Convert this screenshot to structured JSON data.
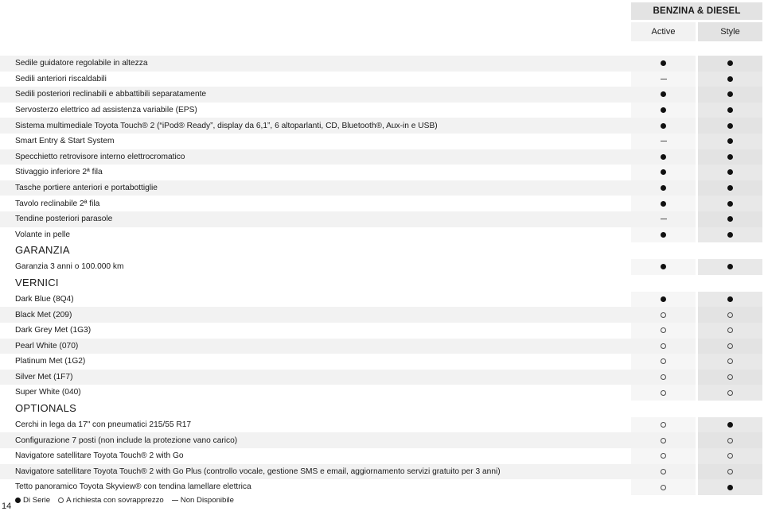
{
  "header": {
    "fuel_band_label": "BENZINA & DIESEL",
    "grades": [
      {
        "label": "Active"
      },
      {
        "label": "Style"
      }
    ]
  },
  "colors": {
    "stripe_feature": "#f2f2f2",
    "active_col": "#f2f2f2",
    "style_col": "#e3e3e3",
    "band": "#e3e3e3",
    "text": "#1a1a1a",
    "marker_filled": "#111111",
    "marker_open_border": "#4a4a4a"
  },
  "rows": [
    {
      "type": "item",
      "label": "Sedile guidatore regolabile in altezza",
      "active": "filled",
      "style": "filled"
    },
    {
      "type": "item",
      "label": "Sedili anteriori riscaldabili",
      "active": "dash",
      "style": "filled"
    },
    {
      "type": "item",
      "label": "Sedili posteriori reclinabili e abbattibili separatamente",
      "active": "filled",
      "style": "filled"
    },
    {
      "type": "item",
      "label": "Servosterzo elettrico ad assistenza variabile (EPS)",
      "active": "filled",
      "style": "filled"
    },
    {
      "type": "item",
      "label": "Sistema multimediale Toyota Touch® 2 (“iPod® Ready”, display da 6,1”, 6 altoparlanti, CD, Bluetooth®, Aux-in e USB)",
      "active": "filled",
      "style": "filled"
    },
    {
      "type": "item",
      "label": "Smart Entry & Start System",
      "active": "dash",
      "style": "filled"
    },
    {
      "type": "item",
      "label": "Specchietto retrovisore interno elettrocromatico",
      "active": "filled",
      "style": "filled"
    },
    {
      "type": "item",
      "label": "Stivaggio inferiore 2ª fila",
      "active": "filled",
      "style": "filled"
    },
    {
      "type": "item",
      "label": "Tasche portiere anteriori e portabottiglie",
      "active": "filled",
      "style": "filled"
    },
    {
      "type": "item",
      "label": "Tavolo reclinabile 2ª fila",
      "active": "filled",
      "style": "filled"
    },
    {
      "type": "item",
      "label": "Tendine posteriori parasole",
      "active": "dash",
      "style": "filled"
    },
    {
      "type": "item",
      "label": "Volante in pelle",
      "active": "filled",
      "style": "filled"
    },
    {
      "type": "section",
      "label": "GARANZIA",
      "active": "none",
      "style": "none"
    },
    {
      "type": "item",
      "label": "Garanzia 3 anni o 100.000 km",
      "active": "filled",
      "style": "filled"
    },
    {
      "type": "section",
      "label": "VERNICI",
      "active": "none",
      "style": "none"
    },
    {
      "type": "item",
      "label": "Dark Blue (8Q4)",
      "active": "filled",
      "style": "filled"
    },
    {
      "type": "item",
      "label": "Black Met (209)",
      "active": "open",
      "style": "open"
    },
    {
      "type": "item",
      "label": "Dark Grey Met (1G3)",
      "active": "open",
      "style": "open"
    },
    {
      "type": "item",
      "label": "Pearl White (070)",
      "active": "open",
      "style": "open"
    },
    {
      "type": "item",
      "label": "Platinum Met (1G2)",
      "active": "open",
      "style": "open"
    },
    {
      "type": "item",
      "label": "Silver Met (1F7)",
      "active": "open",
      "style": "open"
    },
    {
      "type": "item",
      "label": "Super White (040)",
      "active": "open",
      "style": "open"
    },
    {
      "type": "section",
      "label": "OPTIONALS",
      "active": "none",
      "style": "none"
    },
    {
      "type": "item",
      "label": "Cerchi in lega da 17\" con pneumatici 215/55 R17",
      "active": "open",
      "style": "filled"
    },
    {
      "type": "item",
      "label": "Configurazione 7 posti (non include la protezione vano carico)",
      "active": "open",
      "style": "open"
    },
    {
      "type": "item",
      "label": "Navigatore satellitare Toyota Touch® 2 with Go",
      "active": "open",
      "style": "open"
    },
    {
      "type": "item",
      "label": "Navigatore satellitare Toyota Touch® 2 with Go Plus (controllo vocale, gestione SMS e email, aggiornamento servizi gratuito per 3 anni)",
      "active": "open",
      "style": "open"
    },
    {
      "type": "item",
      "label": "Tetto panoramico Toyota Skyview® con tendina lamellare elettrica",
      "active": "open",
      "style": "filled"
    }
  ],
  "legend": [
    {
      "marker": "filled",
      "label": "Di Serie"
    },
    {
      "marker": "open",
      "label": "A richiesta con sovrapprezzo"
    },
    {
      "marker": "dash",
      "label": "Non Disponibile"
    }
  ],
  "footer": {
    "page_number": "14"
  }
}
